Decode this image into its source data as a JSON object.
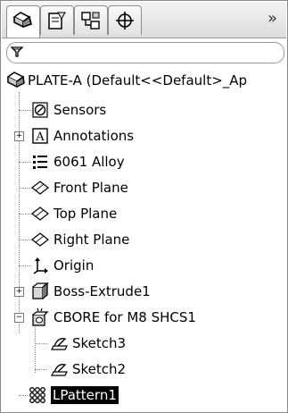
{
  "tabs": [
    {
      "icon": "feature-manager-icon",
      "active": true
    },
    {
      "icon": "property-manager-icon",
      "active": false
    },
    {
      "icon": "configuration-manager-icon",
      "active": false
    },
    {
      "icon": "dimxpert-manager-icon",
      "active": false
    }
  ],
  "overflow_label": "»",
  "filter": {
    "icon": "filter-icon",
    "value": ""
  },
  "tree": {
    "root": "PLATE-A  (Default<<Default>_Ap",
    "items": [
      {
        "label": "Sensors",
        "icon": "sensor-icon"
      },
      {
        "label": "Annotations",
        "icon": "annotation-icon"
      },
      {
        "label": "6061 Alloy",
        "icon": "material-icon"
      },
      {
        "label": "Front Plane",
        "icon": "plane-icon"
      },
      {
        "label": "Top Plane",
        "icon": "plane-icon"
      },
      {
        "label": "Right Plane",
        "icon": "plane-icon"
      },
      {
        "label": "Origin",
        "icon": "origin-icon"
      },
      {
        "label": "Boss-Extrude1",
        "icon": "extrude-icon"
      },
      {
        "label": "CBORE for M8 SHCS1",
        "icon": "hole-wizard-icon"
      },
      {
        "label": "Sketch3",
        "icon": "sketch-icon"
      },
      {
        "label": "Sketch2",
        "icon": "sketch-icon"
      },
      {
        "label": "LPattern1",
        "icon": "linear-pattern-icon",
        "selected": true
      }
    ]
  }
}
